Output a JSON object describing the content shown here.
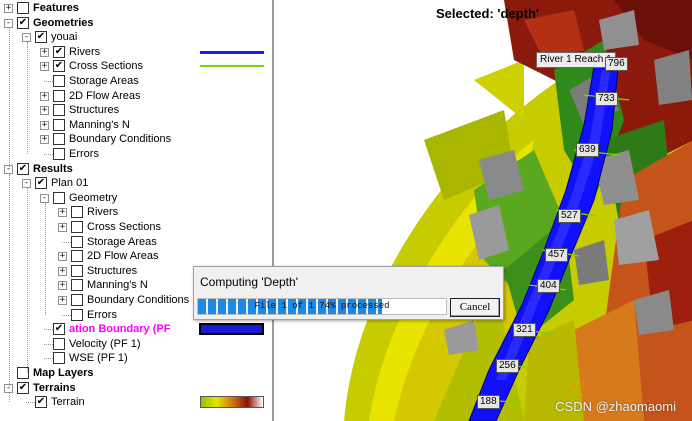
{
  "tree": [
    {
      "key": "features",
      "label": "Features",
      "bold": true,
      "level": 0,
      "expander": "+",
      "checked": false
    },
    {
      "key": "geometries",
      "label": "Geometries",
      "bold": true,
      "level": 0,
      "expander": "-",
      "checked": true
    },
    {
      "key": "youai",
      "label": "youai",
      "bold": false,
      "level": 1,
      "expander": "-",
      "checked": true
    },
    {
      "key": "rivers",
      "label": "Rivers",
      "bold": false,
      "level": 2,
      "expander": "+",
      "checked": true,
      "swatch": "blue-line"
    },
    {
      "key": "cross-sections",
      "label": "Cross Sections",
      "bold": false,
      "level": 2,
      "expander": "+",
      "checked": true,
      "swatch": "green-line"
    },
    {
      "key": "storage-areas",
      "label": "Storage Areas",
      "bold": false,
      "level": 2,
      "expander": null,
      "checked": false
    },
    {
      "key": "2d-flow-areas",
      "label": "2D Flow Areas",
      "bold": false,
      "level": 2,
      "expander": "+",
      "checked": false
    },
    {
      "key": "structures",
      "label": "Structures",
      "bold": false,
      "level": 2,
      "expander": "+",
      "checked": false
    },
    {
      "key": "mannings-n",
      "label": "Manning's N",
      "bold": false,
      "level": 2,
      "expander": "+",
      "checked": false
    },
    {
      "key": "boundary-conditions",
      "label": "Boundary Conditions",
      "bold": false,
      "level": 2,
      "expander": "+",
      "checked": false
    },
    {
      "key": "errors",
      "label": "Errors",
      "bold": false,
      "level": 2,
      "expander": null,
      "checked": false
    },
    {
      "key": "results",
      "label": "Results",
      "bold": true,
      "level": 0,
      "expander": "-",
      "checked": true
    },
    {
      "key": "plan-01",
      "label": "Plan 01",
      "bold": false,
      "level": 1,
      "expander": "-",
      "checked": true
    },
    {
      "key": "geometry",
      "label": "Geometry",
      "bold": false,
      "level": 2,
      "expander": "-",
      "checked": false
    },
    {
      "key": "res-rivers",
      "label": "Rivers",
      "bold": false,
      "level": 3,
      "expander": "+",
      "checked": false
    },
    {
      "key": "res-cross-sections",
      "label": "Cross Sections",
      "bold": false,
      "level": 3,
      "expander": "+",
      "checked": false
    },
    {
      "key": "res-storage-areas",
      "label": "Storage Areas",
      "bold": false,
      "level": 3,
      "expander": null,
      "checked": false
    },
    {
      "key": "res-2d-flow-areas",
      "label": "2D Flow Areas",
      "bold": false,
      "level": 3,
      "expander": "+",
      "checked": false
    },
    {
      "key": "res-structures",
      "label": "Structures",
      "bold": false,
      "level": 3,
      "expander": "+",
      "checked": false
    },
    {
      "key": "res-mannings-n",
      "label": "Manning's N",
      "bold": false,
      "level": 3,
      "expander": "+",
      "checked": false
    },
    {
      "key": "res-boundary-conditions",
      "label": "Boundary Conditions",
      "bold": false,
      "level": 3,
      "expander": "+",
      "checked": false
    },
    {
      "key": "res-errors",
      "label": "Errors",
      "bold": false,
      "level": 3,
      "expander": null,
      "checked": false
    },
    {
      "key": "depth",
      "label": "ation Boundary (PF",
      "bold": true,
      "level": 2,
      "expander": null,
      "checked": true,
      "swatch": "depth-bar",
      "color": "#ff00ff"
    },
    {
      "key": "velocity",
      "label": "Velocity (PF 1)",
      "bold": false,
      "level": 2,
      "expander": null,
      "checked": false
    },
    {
      "key": "wse",
      "label": "WSE (PF 1)",
      "bold": false,
      "level": 2,
      "expander": null,
      "checked": false
    },
    {
      "key": "map-layers",
      "label": "Map Layers",
      "bold": true,
      "level": 0,
      "expander": null,
      "checked": false
    },
    {
      "key": "terrains",
      "label": "Terrains",
      "bold": true,
      "level": 0,
      "expander": "-",
      "checked": true
    },
    {
      "key": "terrain",
      "label": "Terrain",
      "bold": false,
      "level": 1,
      "expander": null,
      "checked": true,
      "swatch": "terrain-ramp"
    }
  ],
  "map": {
    "selected_label": "Selected: 'depth'",
    "reach_label": "River 1  Reach 1",
    "stations": [
      "796",
      "733",
      "639",
      "527",
      "457",
      "404",
      "321",
      "256",
      "188"
    ],
    "watermark": "CSDN @zhaomaomi"
  },
  "dialog": {
    "title": "Computing 'Depth'",
    "progress_text": "File 1 of 1  74% processed",
    "progress": 0.74,
    "cancel_label": "Cancel"
  },
  "colors": {
    "river_line": "#1a1aff",
    "cross_section_line": "#7fd400",
    "depth_text": "#ff00ff",
    "progress_fill": "#1e88e5",
    "depth_water": "#1010ff"
  }
}
